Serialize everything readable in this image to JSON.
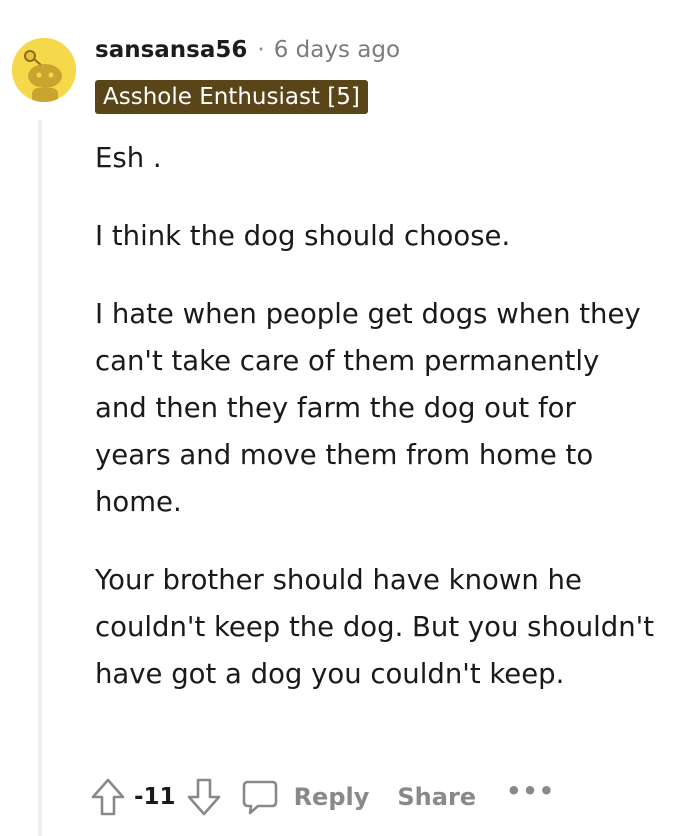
{
  "comment": {
    "username": "sansansa56",
    "separator": "·",
    "timestamp": "6 days ago",
    "flair": "Asshole Enthusiast [5]",
    "paragraphs": [
      "Esh .",
      "I think the dog should choose.",
      "I hate when people get dogs when they can't take care of them permanently and then they farm the dog out for years and move them from home to home.",
      "Your brother should have known he couldn't keep the dog. But you shouldn't have got a dog you couldn't keep."
    ]
  },
  "actions": {
    "upvote_icon": "upvote-arrow-icon",
    "score": "-11",
    "downvote_icon": "downvote-arrow-icon",
    "reply_icon": "comment-bubble-icon",
    "reply_label": "Reply",
    "share_label": "Share",
    "more_label": "•••"
  },
  "colors": {
    "avatar_background": "#f5d94a",
    "flair_background": "#5a4519",
    "muted_text": "#878a8c",
    "thread_line": "#edeff1"
  }
}
